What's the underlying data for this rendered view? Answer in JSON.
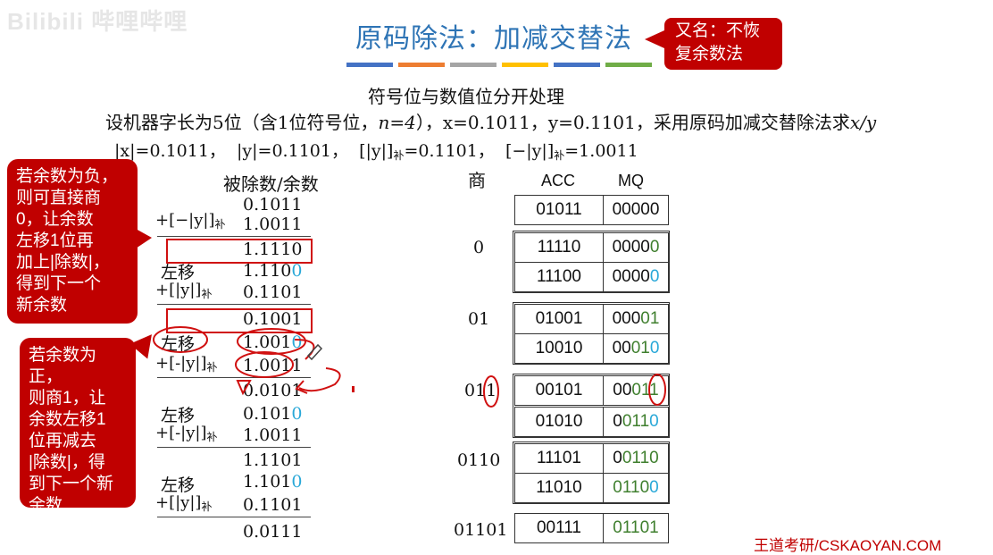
{
  "watermark": "Bilibili 哔哩哔哩",
  "title": "原码除法：加减交替法",
  "title_bar_colors": [
    "#4472c4",
    "#ed7d31",
    "#a5a5a5",
    "#ffc000",
    "#4472c4",
    "#70ad47"
  ],
  "callout_top": {
    "line1": "又名：不恢",
    "line2": "复余数法"
  },
  "subtitle": "符号位与数值位分开处理",
  "problem": {
    "prefix": "设机器字长为5位（含1位符号位，",
    "n": "n=4",
    "middle": "），x=0.1011，y=0.1101，采用原码加减交替除法求",
    "target": "x/y"
  },
  "abs_values": {
    "x": "|x|=0.1011，",
    "y": "|y|=0.1101，",
    "y_comp": "[|y|]",
    "y_comp_val": "=0.1101，",
    "neg_y_comp": "[−|y|]",
    "neg_y_comp_val": "=1.0011",
    "sub": "补"
  },
  "callout_neg": {
    "lines": [
      "若余数为负，",
      "则可直接商",
      "0，让余数",
      "左移1位再",
      "加上|除数|，",
      "得到下一个",
      "新余数"
    ]
  },
  "callout_pos": {
    "lines": [
      "若余数为正，",
      "则商1，让",
      "余数左移1",
      "位再减去",
      "|除数|，得",
      "到下一个新",
      "余数"
    ]
  },
  "headers": {
    "dividend": "被除数/余数",
    "quotient": "商",
    "acc": "ACC",
    "mq": "MQ"
  },
  "ops": {
    "neg_y": "+[−|y|]",
    "neg_y2": "+[-|y|]",
    "pos_y": "+[|y|]",
    "shift": "左移",
    "sub": "补"
  },
  "left_values": {
    "v1": "0.1011",
    "v2": "1.0011",
    "v3": "1.1110",
    "v4_main": "1.110",
    "v4_tail": "0",
    "v5": "0.1101",
    "v6": "0.1001",
    "v7_main": "1.001",
    "v7_tail": "0",
    "v8": "1.0011",
    "v9": "0.0101",
    "v10_main": "0.101",
    "v10_tail": "0",
    "v11": "1.0011",
    "v12": "1.1101",
    "v13_main": "1.101",
    "v13_tail": "0",
    "v14": "0.1101",
    "v15": "0.0111"
  },
  "quotients": [
    "0",
    "01",
    "011",
    "0110",
    "01101"
  ],
  "table": {
    "r0": {
      "acc": "01011",
      "mq": "00000"
    },
    "r1": {
      "acc": "11110",
      "mq_a": "0000",
      "mq_b": "0"
    },
    "r2": {
      "acc": "11100",
      "mq_a": "0000",
      "mq_b": "0"
    },
    "r3": {
      "acc": "01001",
      "mq_a": "000",
      "mq_b": "01"
    },
    "r4": {
      "acc": "10010",
      "mq_a": "00",
      "mq_b": "01",
      "mq_c": "0"
    },
    "r5": {
      "acc": "00101",
      "mq_a": "00",
      "mq_b": "011"
    },
    "r6": {
      "acc": "01010",
      "mq_a": "0",
      "mq_b": "011",
      "mq_c": "0"
    },
    "r7": {
      "acc": "11101",
      "mq_a": "0",
      "mq_b": "0110"
    },
    "r8": {
      "acc": "11010",
      "mq_b": "0110",
      "mq_c": "0"
    },
    "r9": {
      "acc": "00111",
      "mq_b": "01101"
    }
  },
  "footer": "王道考研/CSKAOYAN.COM"
}
